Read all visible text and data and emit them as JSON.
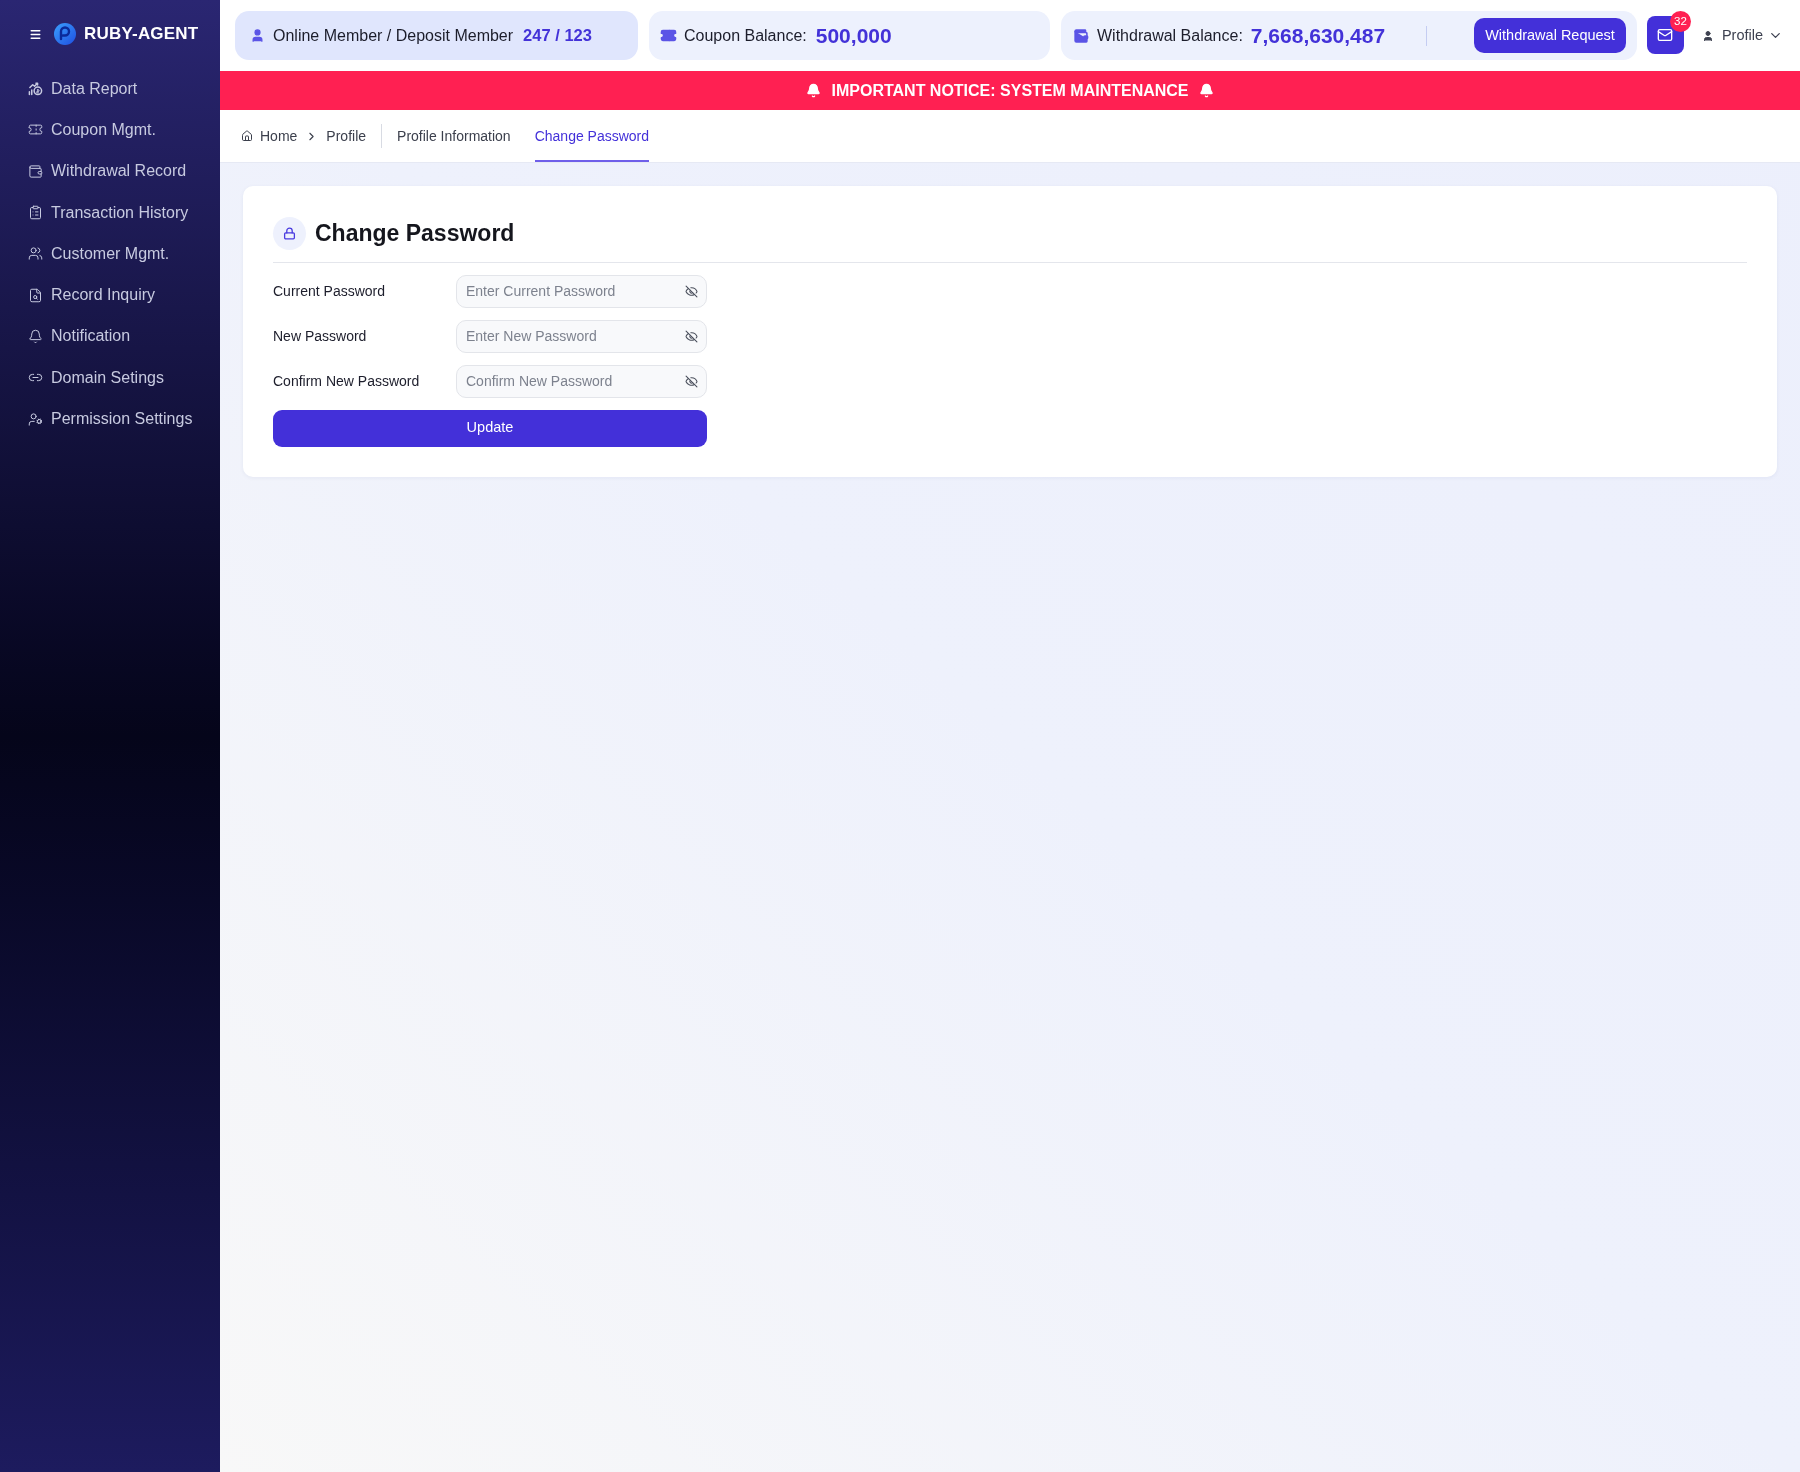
{
  "sidebar": {
    "brand": "RUBY-AGENT",
    "items": [
      {
        "label": "Data Report"
      },
      {
        "label": "Coupon Mgmt."
      },
      {
        "label": "Withdrawal Record"
      },
      {
        "label": "Transaction History"
      },
      {
        "label": "Customer Mgmt."
      },
      {
        "label": "Record Inquiry"
      },
      {
        "label": "Notification"
      },
      {
        "label": "Domain Setings"
      },
      {
        "label": "Permission Settings"
      }
    ]
  },
  "top_bar": {
    "member_count": {
      "label": "Online Member / Deposit Member",
      "value": "247 / 123"
    },
    "coupon_balance": {
      "label": "Coupon Balance:",
      "value": "500,000"
    },
    "withdrawal_balance": {
      "label": "Withdrawal Balance:",
      "value": "7,668,630,487",
      "button": "Withdrawal Request"
    },
    "mail_badge": "32",
    "profile": "Profile"
  },
  "notice": "IMPORTANT NOTICE: SYSTEM MAINTENANCE",
  "breadcrumb": [
    "Home",
    "Profile"
  ],
  "tabs": [
    {
      "label": "Profile Information",
      "selected": false
    },
    {
      "label": "Change Password",
      "selected": true
    }
  ],
  "form": {
    "title": "Change Password",
    "fields": [
      {
        "label": "Current Password",
        "placeholder": "Enter Current Password"
      },
      {
        "label": "New Password",
        "placeholder": "Enter New Password"
      },
      {
        "label": "Confirm New Password",
        "placeholder": "Confirm New Password"
      }
    ],
    "submit": "Update"
  }
}
